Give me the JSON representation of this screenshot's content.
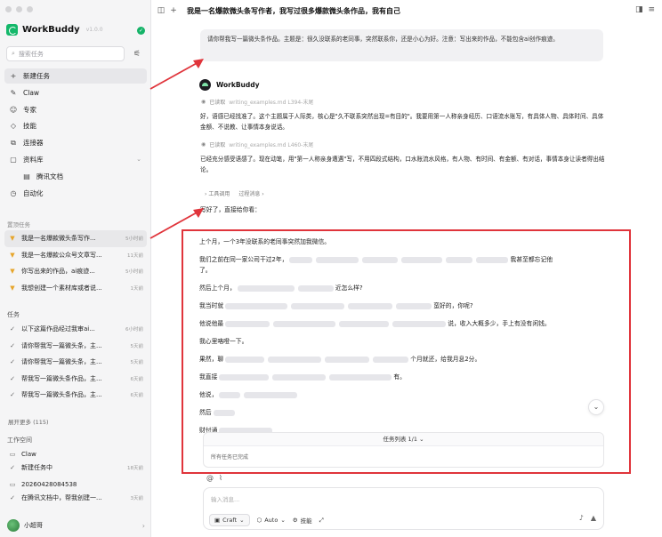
{
  "app": {
    "name": "WorkBuddy",
    "version": "v1.0.0"
  },
  "sidebar": {
    "search_placeholder": "搜索任务",
    "nav": [
      {
        "label": "新建任务",
        "icon": "plus-icon"
      },
      {
        "label": "Claw",
        "icon": "claw-icon"
      },
      {
        "label": "专家",
        "icon": "expert-icon"
      },
      {
        "label": "技能",
        "icon": "skill-icon"
      },
      {
        "label": "连接器",
        "icon": "connector-icon"
      },
      {
        "label": "资料库",
        "icon": "library-icon"
      },
      {
        "label": "腾讯文档",
        "icon": "doc-icon"
      },
      {
        "label": "自动化",
        "icon": "clock-icon"
      }
    ],
    "pinned_label": "置顶任务",
    "pinned": [
      {
        "title": "我是一名爆款微头条写作...",
        "time": "5小时前"
      },
      {
        "title": "我是一名爆款公众号文章写...",
        "time": "11天前"
      },
      {
        "title": "你写出来的作品，ai痕迹...",
        "time": "5小时前"
      },
      {
        "title": "我想创建一个素材库或者说...",
        "time": "1天前"
      }
    ],
    "tasks_label": "任务",
    "tasks": [
      {
        "title": "以下这篇作品经过我审ai...",
        "time": "6小时前"
      },
      {
        "title": "请你帮我写一篇微头条，主...",
        "time": "5天前"
      },
      {
        "title": "请你帮我写一篇微头条，主...",
        "time": "5天前"
      },
      {
        "title": "帮我写一篇微头条作品，主...",
        "time": "6天前"
      },
      {
        "title": "帮我写一篇微头条作品，主...",
        "time": "6天前"
      }
    ],
    "expand_more": "展开更多 (115)",
    "workspace_label": "工作空间",
    "workspace": [
      {
        "title": "Claw",
        "icon": "folder-icon",
        "time": ""
      },
      {
        "title": "新建任务中",
        "icon": "check-icon",
        "time": "18天前"
      },
      {
        "title": "20260428084538",
        "icon": "folder-icon",
        "time": ""
      },
      {
        "title": "在腾讯文档中，帮我创建一...",
        "icon": "check-icon",
        "time": "3天前"
      }
    ],
    "user_name": "小超哥"
  },
  "topbar": {
    "title": "我是一名爆款微头条写作者，我写过很多爆款微头条作品，我有自己"
  },
  "chat": {
    "user_message": "请你帮我写一篇微头条作品。主题是：很久没联系的老同事，突然联系你，还是小心为好。注意：写出来的作品，不能包含ai创作痕迹。",
    "bot_name": "WorkBuddy",
    "read1_label": "已读取",
    "read1_file": "writing_examples.md  L394-末尾",
    "para1": "好，语感已经找准了。这个主题属于人际类，核心是\"久不联系突然出现=有目的\"。我要用第一人称亲身经历、口语流水账写，有具体人物、具体时间、具体金额、不说教、让事情本身说话。",
    "read2_label": "已读取",
    "read2_file": "writing_examples.md  L460-末尾",
    "para2": "已经充分感受语感了。现在动笔，用\"第一人称亲身遭遇\"写，不用四段式结构，口水账流水风格，有人物、有时间、有金额、有对话，事情本身让读者得出结论。",
    "tool_call": "工具调用",
    "process": "过程消息",
    "written": "写好了，直接给你看："
  },
  "document": {
    "lines": [
      "上个月，一个3年没联系的老同事突然加我微信。",
      "我们之前在同一家公司干过2年，",
      "了。",
      "然后上个月，",
      "我当时就",
      "他说他最",
      "我心里咯噔一下。",
      "果然，聊",
      "我直接",
      "他说，",
      "然后",
      "财付通"
    ],
    "fragments": {
      "l2_end": "我甚至都忘记他",
      "l4_end": "近怎么样?",
      "l5_end": "蛮好的，你呢?",
      "l6_end": "说，收入大概多少，手上有没有闲钱。",
      "l8_end": "个月就还，给我月息2分。",
      "l9_end": "有。"
    }
  },
  "tasklist": {
    "title": "任务列表 1/1",
    "status": "所有任务已完成"
  },
  "composer": {
    "placeholder": "输入消息...",
    "mode": "Craft",
    "model": "Auto",
    "skill": "技能"
  },
  "colors": {
    "accent": "#14b86a",
    "annotation": "#e0343b",
    "pinned_icon": "#e6a52b"
  }
}
